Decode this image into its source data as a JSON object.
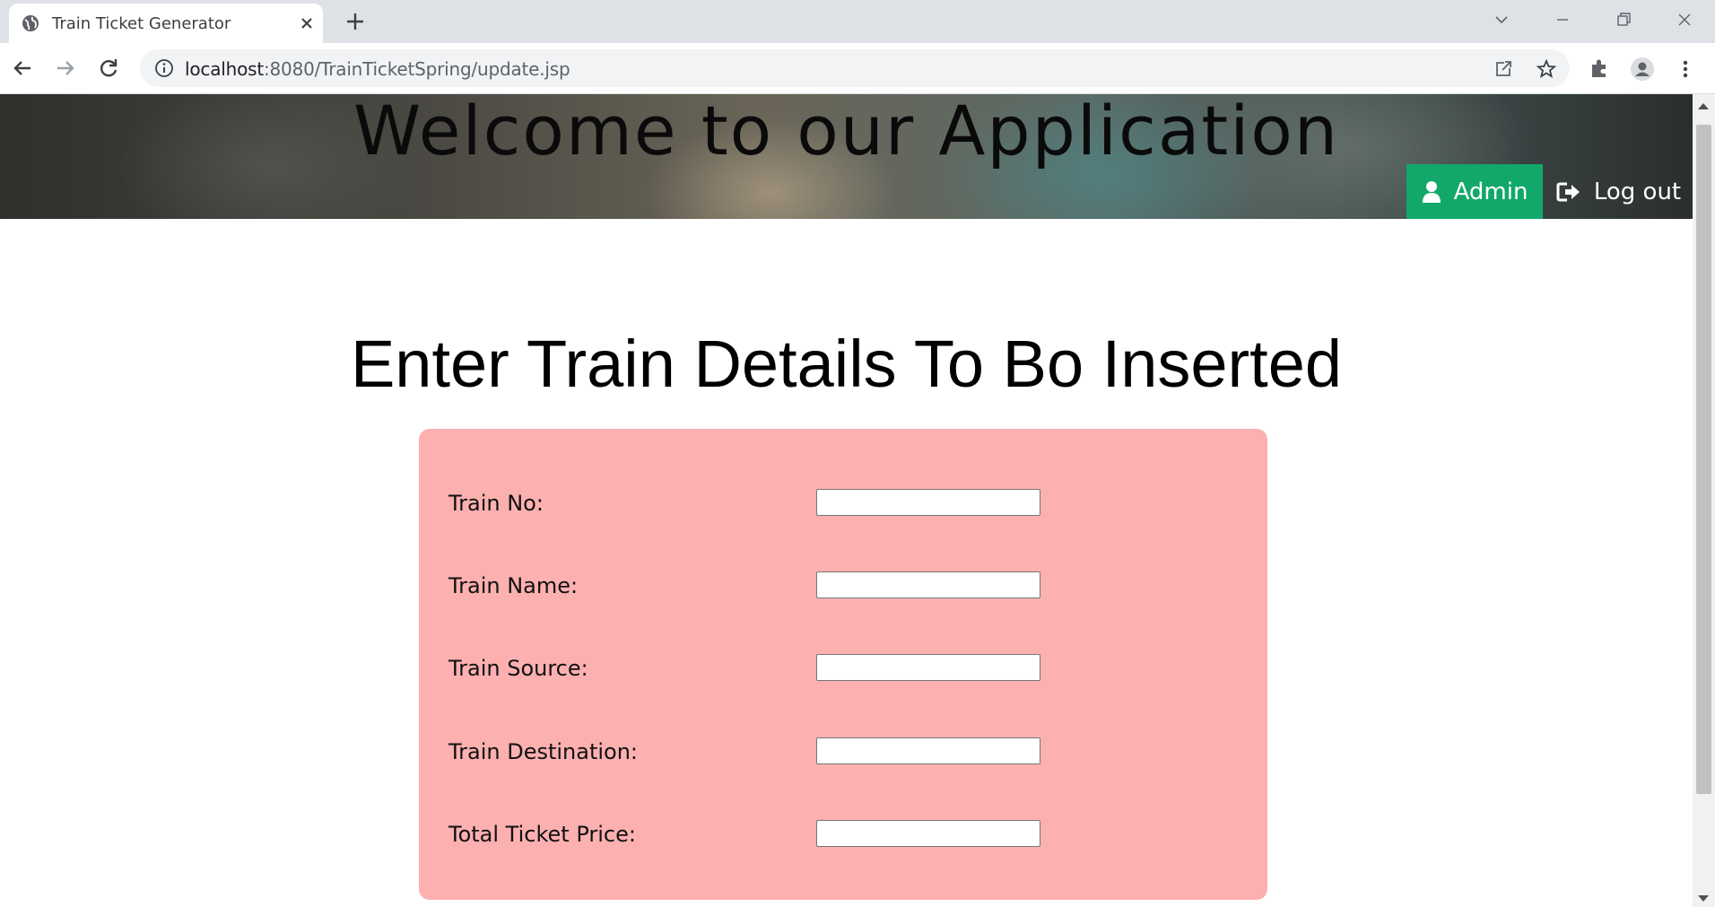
{
  "browser": {
    "tab_title": "Train Ticket Generator",
    "url_host": "localhost",
    "url_rest": ":8080/TrainTicketSpring/update.jsp"
  },
  "banner": {
    "title": "Welcome to our Application",
    "admin_label": "Admin",
    "logout_label": "Log out",
    "admin_color": "#12a86a"
  },
  "main": {
    "heading": "Enter Train Details To Bo Inserted",
    "form_background": "#fcb0b0",
    "fields": [
      {
        "label": "Train No:",
        "value": ""
      },
      {
        "label": "Train Name:",
        "value": ""
      },
      {
        "label": "Train Source:",
        "value": ""
      },
      {
        "label": "Train Destination:",
        "value": ""
      },
      {
        "label": "Total Ticket Price:",
        "value": ""
      }
    ]
  }
}
